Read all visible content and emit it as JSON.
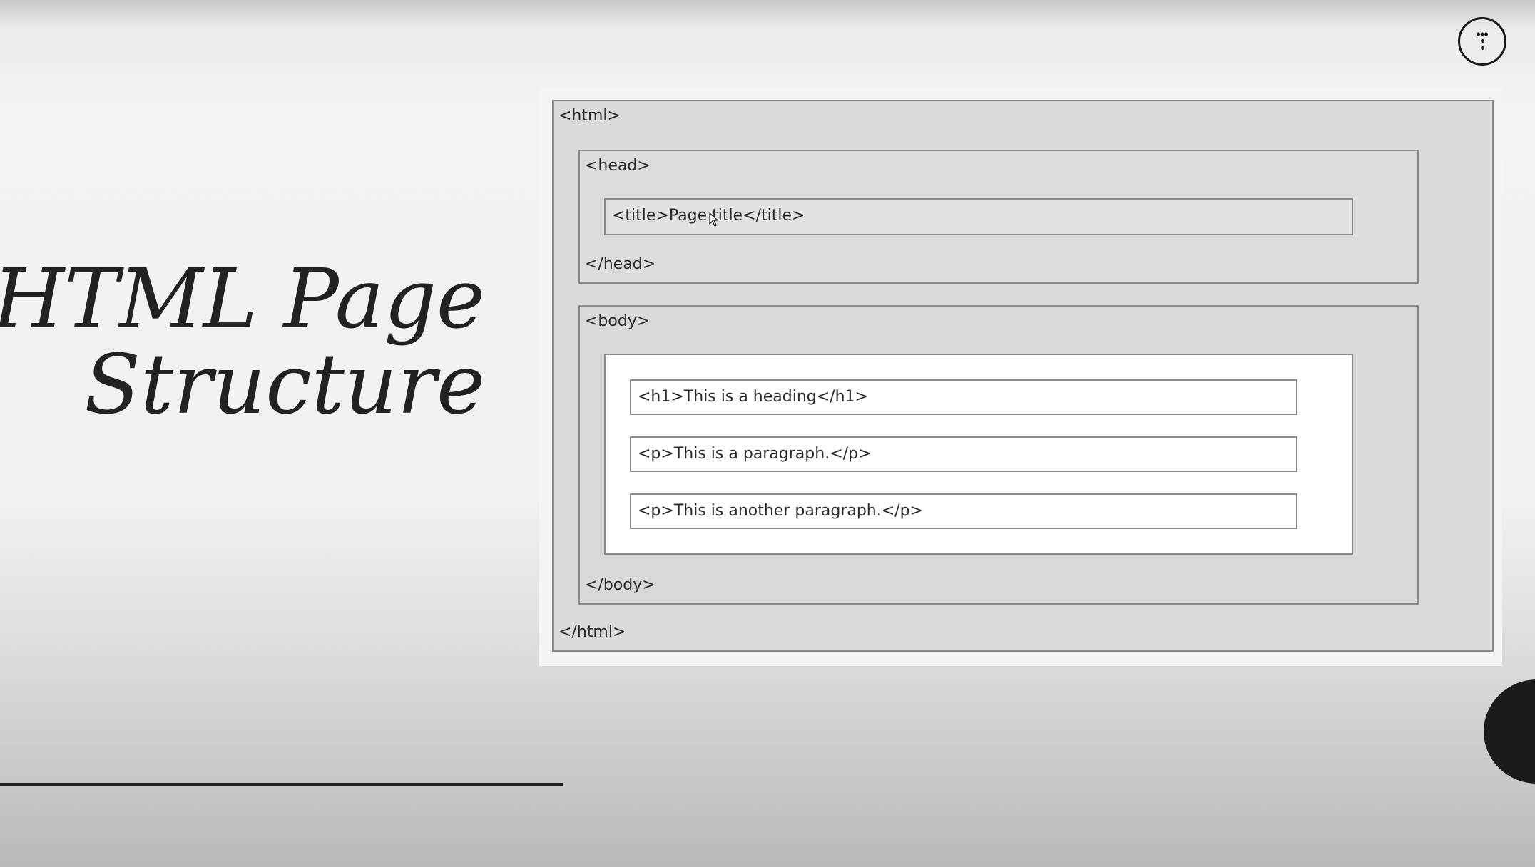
{
  "slide": {
    "title_line1": "HTML Page",
    "title_line2": "Structure"
  },
  "diagram": {
    "html_open": "<html>",
    "html_close": "</html>",
    "head_open": "<head>",
    "head_close": "</head>",
    "title_element": "<title>Page title</title>",
    "body_open": "<body>",
    "body_close": "</body>",
    "body_lines": [
      "<h1>This is a heading</h1>",
      "<p>This is a paragraph.</p>",
      "<p>This is another paragraph.</p>"
    ]
  },
  "controls": {
    "menu_icon": "vertical-dots-menu-icon",
    "cursor_icon": "mouse-pointer-icon"
  },
  "colors": {
    "title_text": "#222222",
    "panel_background": "#f4f4f4",
    "html_box": "#dbdbdb",
    "body_content_box": "#ffffff",
    "box_border": "#8a8a8a"
  }
}
